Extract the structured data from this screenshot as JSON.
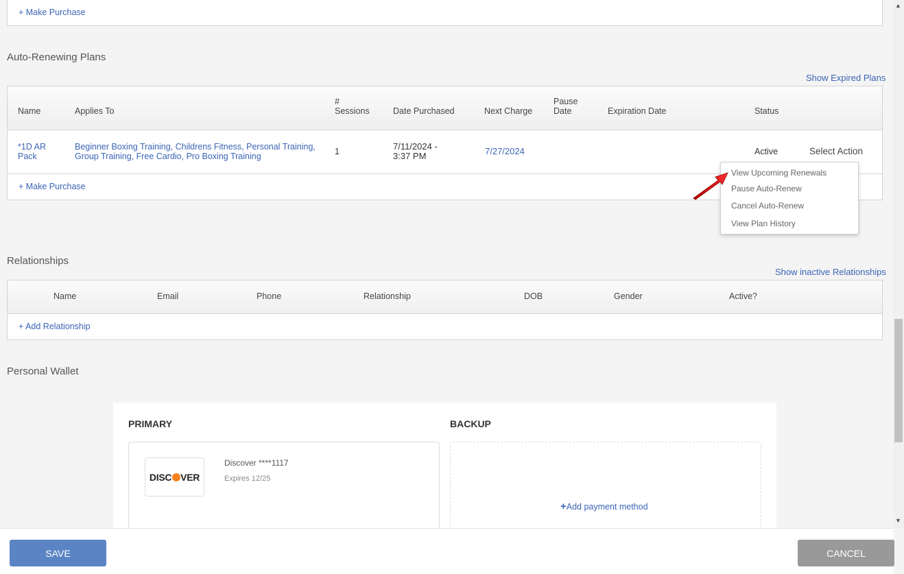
{
  "top_panel": {
    "make_purchase": "+ Make Purchase"
  },
  "auto_renew": {
    "title": "Auto-Renewing Plans",
    "show_expired": "Show Expired Plans",
    "headers": {
      "name": "Name",
      "applies_to": "Applies To",
      "sessions_line1": "#",
      "sessions_line2": "Sessions",
      "date_purchased": "Date Purchased",
      "next_charge": "Next Charge",
      "pause_line1": "Pause",
      "pause_line2": "Date",
      "expiration_date": "Expiration Date",
      "status": "Status"
    },
    "row": {
      "name_line1": "*1D AR",
      "name_line2": "Pack",
      "applies_line1": "Beginner Boxing Training, Childrens Fitness, Personal Training,",
      "applies_line2": "Group Training, Free Cardio, Pro Boxing Training",
      "sessions": "1",
      "date_line1": "7/11/2024 -",
      "date_line2": "3:37 PM",
      "next_charge": "7/27/2024",
      "status": "Active",
      "select_action": "Select Action"
    },
    "make_purchase": "+ Make Purchase"
  },
  "action_menu": {
    "items": [
      "View Upcoming Renewals",
      "Pause Auto-Renew",
      "Cancel Auto-Renew",
      "View Plan History"
    ]
  },
  "relationships": {
    "title": "Relationships",
    "show_inactive": "Show inactive Relationships",
    "headers": {
      "name": "Name",
      "email": "Email",
      "phone": "Phone",
      "relationship": "Relationship",
      "dob": "DOB",
      "gender": "Gender",
      "active": "Active?"
    },
    "add": "+ Add Relationship"
  },
  "wallet": {
    "title": "Personal Wallet",
    "primary": "PRIMARY",
    "backup": "BACKUP",
    "card_brand_pre": "DISC",
    "card_brand_post": "VER",
    "card_name": "Discover ****1117",
    "card_expires": "Expires 12/25",
    "add_payment": "Add payment method"
  },
  "footer": {
    "save": "SAVE",
    "cancel": "CANCEL"
  },
  "colors": {
    "link": "#3a64b5",
    "save_button": "#5b84c4",
    "cancel_button": "#999999",
    "arrow": "#e01b1b",
    "discover_orange": "#f58220"
  }
}
